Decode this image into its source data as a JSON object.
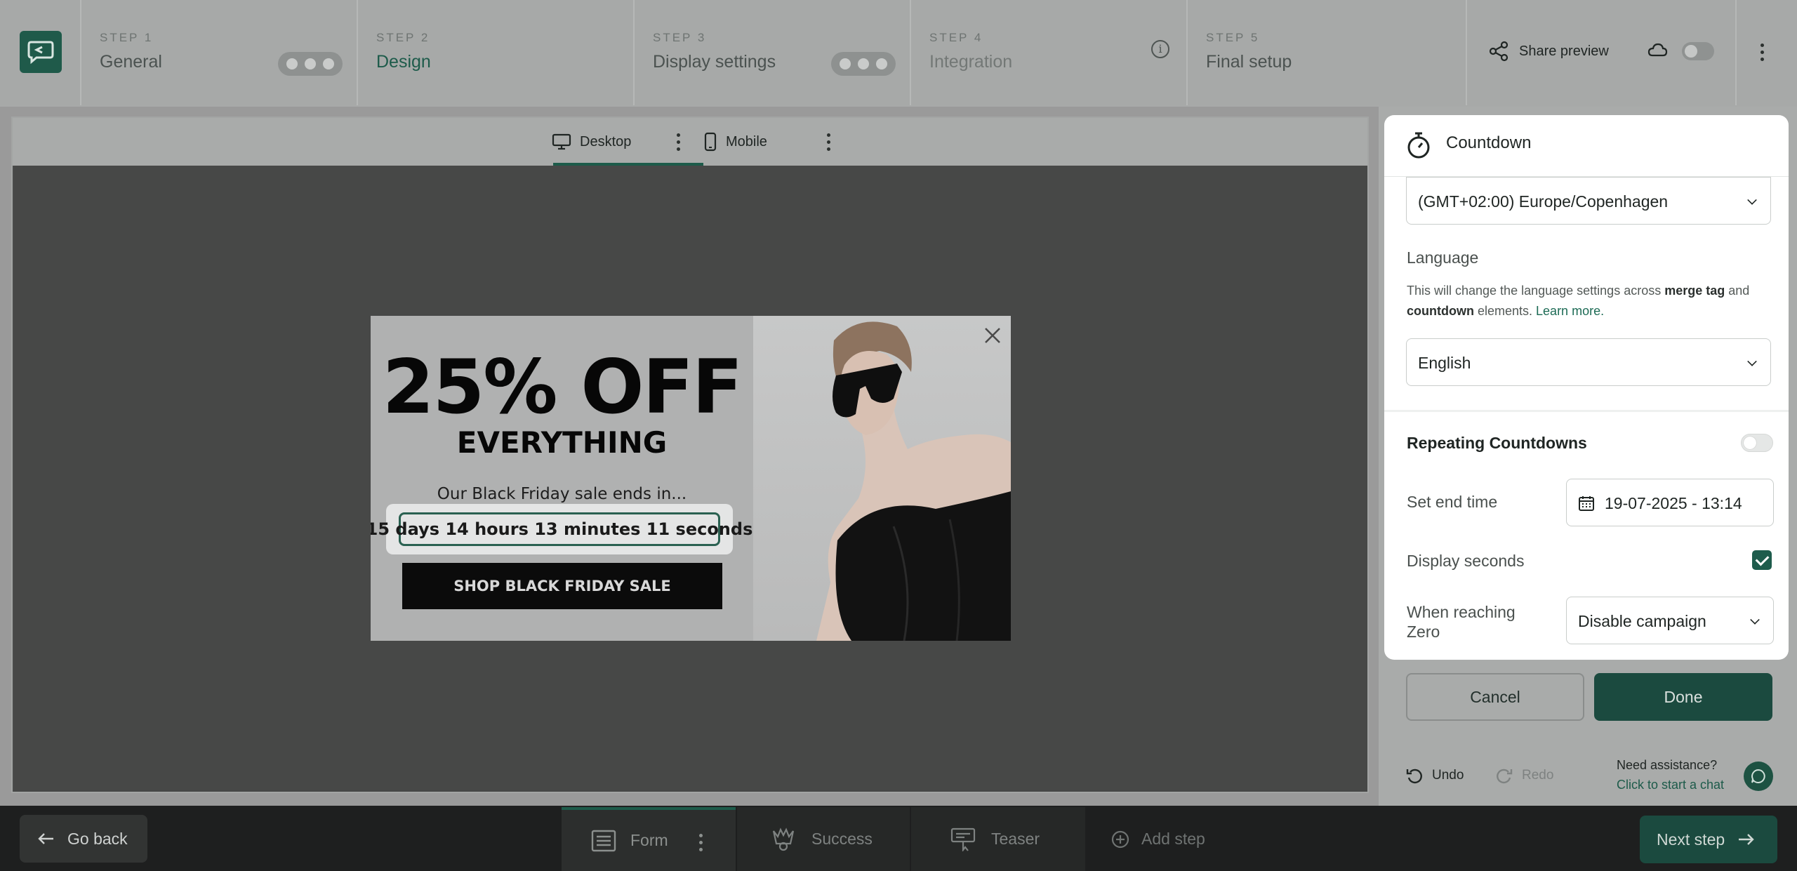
{
  "steps": [
    {
      "num": "STEP 1",
      "name": "General"
    },
    {
      "num": "STEP 2",
      "name": "Design"
    },
    {
      "num": "STEP 3",
      "name": "Display settings"
    },
    {
      "num": "STEP 4",
      "name": "Integration"
    },
    {
      "num": "STEP 5",
      "name": "Final setup"
    }
  ],
  "header": {
    "share_label": "Share preview"
  },
  "devices": {
    "desktop": "Desktop",
    "mobile": "Mobile"
  },
  "popup": {
    "headline": "25% OFF",
    "subheadline": "EVERYTHING",
    "ends_text": "Our Black Friday sale ends in...",
    "countdown": "15 days 14 hours 13 minutes 11 seconds",
    "cta": "SHOP BLACK FRIDAY SALE"
  },
  "panel": {
    "title": "Countdown",
    "timezone_value": "(GMT+02:00) Europe/Copenhagen",
    "language_label": "Language",
    "language_help_1": "This will change the language settings across ",
    "language_help_b1": "merge tag",
    "language_help_2": " and ",
    "language_help_b2": "countdown",
    "language_help_3": " elements. ",
    "language_help_link": "Learn more.",
    "language_value": "English",
    "repeating_label": "Repeating Countdowns",
    "end_time_label": "Set end time",
    "end_time_value": "19-07-2025 - 13:14",
    "display_seconds_label": "Display seconds",
    "zero_label": "When reaching Zero",
    "zero_value": "Disable campaign"
  },
  "actions": {
    "cancel": "Cancel",
    "done": "Done",
    "undo": "Undo",
    "redo": "Redo"
  },
  "assist": {
    "question": "Need assistance?",
    "link": "Click to start a chat"
  },
  "bottom": {
    "go_back": "Go back",
    "form": "Form",
    "success": "Success",
    "teaser": "Teaser",
    "add_step": "Add step",
    "next_step": "Next step"
  },
  "colors": {
    "brand": "#1d5b4a",
    "brand_dark": "#1b4a3f"
  }
}
